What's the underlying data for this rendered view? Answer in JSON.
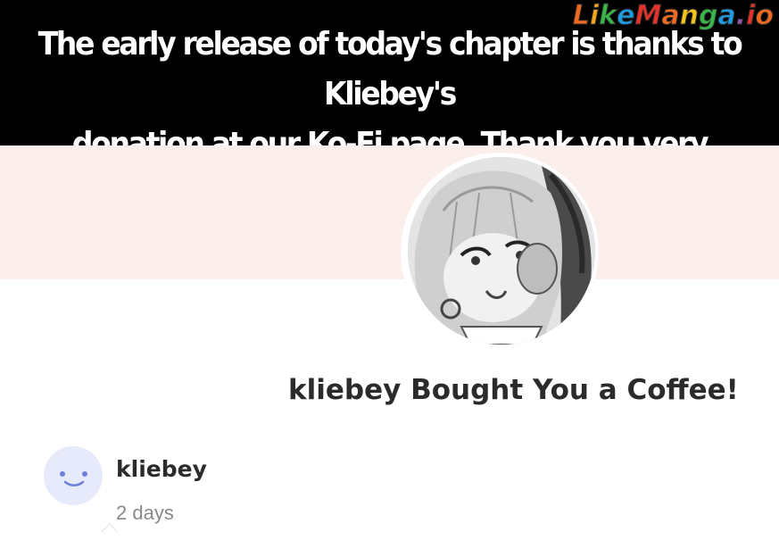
{
  "banner": {
    "line1": "The early release of today's chapter is thanks to Kliebey's",
    "line2": "donation at our Ko-Fi page. Thank you very much :D"
  },
  "watermark": {
    "text": "LikeManga.io",
    "letter_colors": [
      "#f06a20",
      "#f2a51d",
      "#3ab54a",
      "#1e9be0",
      "#e6312b",
      "#f06a20",
      "#f2c21d",
      "#3ab54a",
      "#1e9be0",
      "#9b59b6",
      "#e6312b",
      "#f06a20"
    ]
  },
  "profile": {
    "avatar_icon": "anime-girl-avatar",
    "headline": "kliebey Bought You a Coffee!"
  },
  "donation": {
    "avatar_icon": "smiley-face-icon",
    "name": "kliebey",
    "time": "2 days"
  },
  "colors": {
    "banner_bg": "#000000",
    "header_band": "#fcefeb",
    "donor_avatar_bg": "#e6eafb",
    "donor_avatar_fg": "#6e7fd8",
    "text_dark": "#2b2b2b",
    "text_muted": "#8a8a8a"
  }
}
